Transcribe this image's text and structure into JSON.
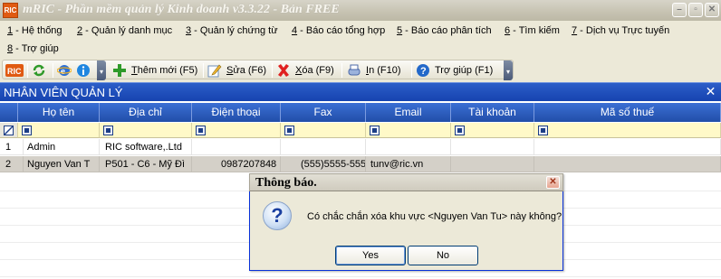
{
  "window": {
    "logo": "RIC",
    "title": "mRIC - Phần mềm quản lý Kinh doanh v3.3.22 - Bản FREE"
  },
  "menu": [
    {
      "key": "1",
      "label": " - Hệ thống"
    },
    {
      "key": "2",
      "label": " - Quản lý danh mục"
    },
    {
      "key": "3",
      "label": " - Quản lý chứng từ"
    },
    {
      "key": "4",
      "label": " - Báo cáo tổng hợp"
    },
    {
      "key": "5",
      "label": " - Báo cáo phân tích"
    },
    {
      "key": "6",
      "label": " - Tìm kiếm"
    },
    {
      "key": "7",
      "label": " - Dịch vụ Trực tuyến"
    },
    {
      "key": "8",
      "label": " - Trợ giúp"
    }
  ],
  "toolbar": {
    "add": {
      "key": "T",
      "rest": "hêm mới (F5)"
    },
    "edit": {
      "key": "S",
      "rest": "ửa (F6)"
    },
    "delete": {
      "key": "X",
      "rest": "óa (F9)"
    },
    "print": {
      "key": "I",
      "rest": "n (F10)"
    },
    "help": {
      "key": "",
      "rest": "Trợ giúp (F1)"
    }
  },
  "panel": {
    "title": "NHÂN VIÊN QUẢN LÝ",
    "close": "✕"
  },
  "table": {
    "columns": [
      "Họ tên",
      "Địa chỉ",
      "Điện thoại",
      "Fax",
      "Email",
      "Tài khoản",
      "Mã số thuế"
    ],
    "rows": [
      {
        "no": "1",
        "name": "Admin",
        "address": "RIC software,.Ltd",
        "phone": "",
        "fax": "",
        "email": "",
        "account": "",
        "tax": ""
      },
      {
        "no": "2",
        "name": "Nguyen Van T",
        "address": "P501 - C6 - Mỹ Đì",
        "phone": "0987207848",
        "fax": "(555)5555-555",
        "email": "tunv@ric.vn",
        "account": "",
        "tax": ""
      }
    ]
  },
  "dialog": {
    "title": "Thông báo.",
    "message": "Có chắc chắn xóa khu vực <Nguyen Van Tu> này không?",
    "yes": "Yes",
    "no": "No"
  },
  "colors": {
    "header_blue": "#2c5ec8",
    "filter_yellow": "#fff9c8",
    "selected_row": "#d4d0c8"
  }
}
